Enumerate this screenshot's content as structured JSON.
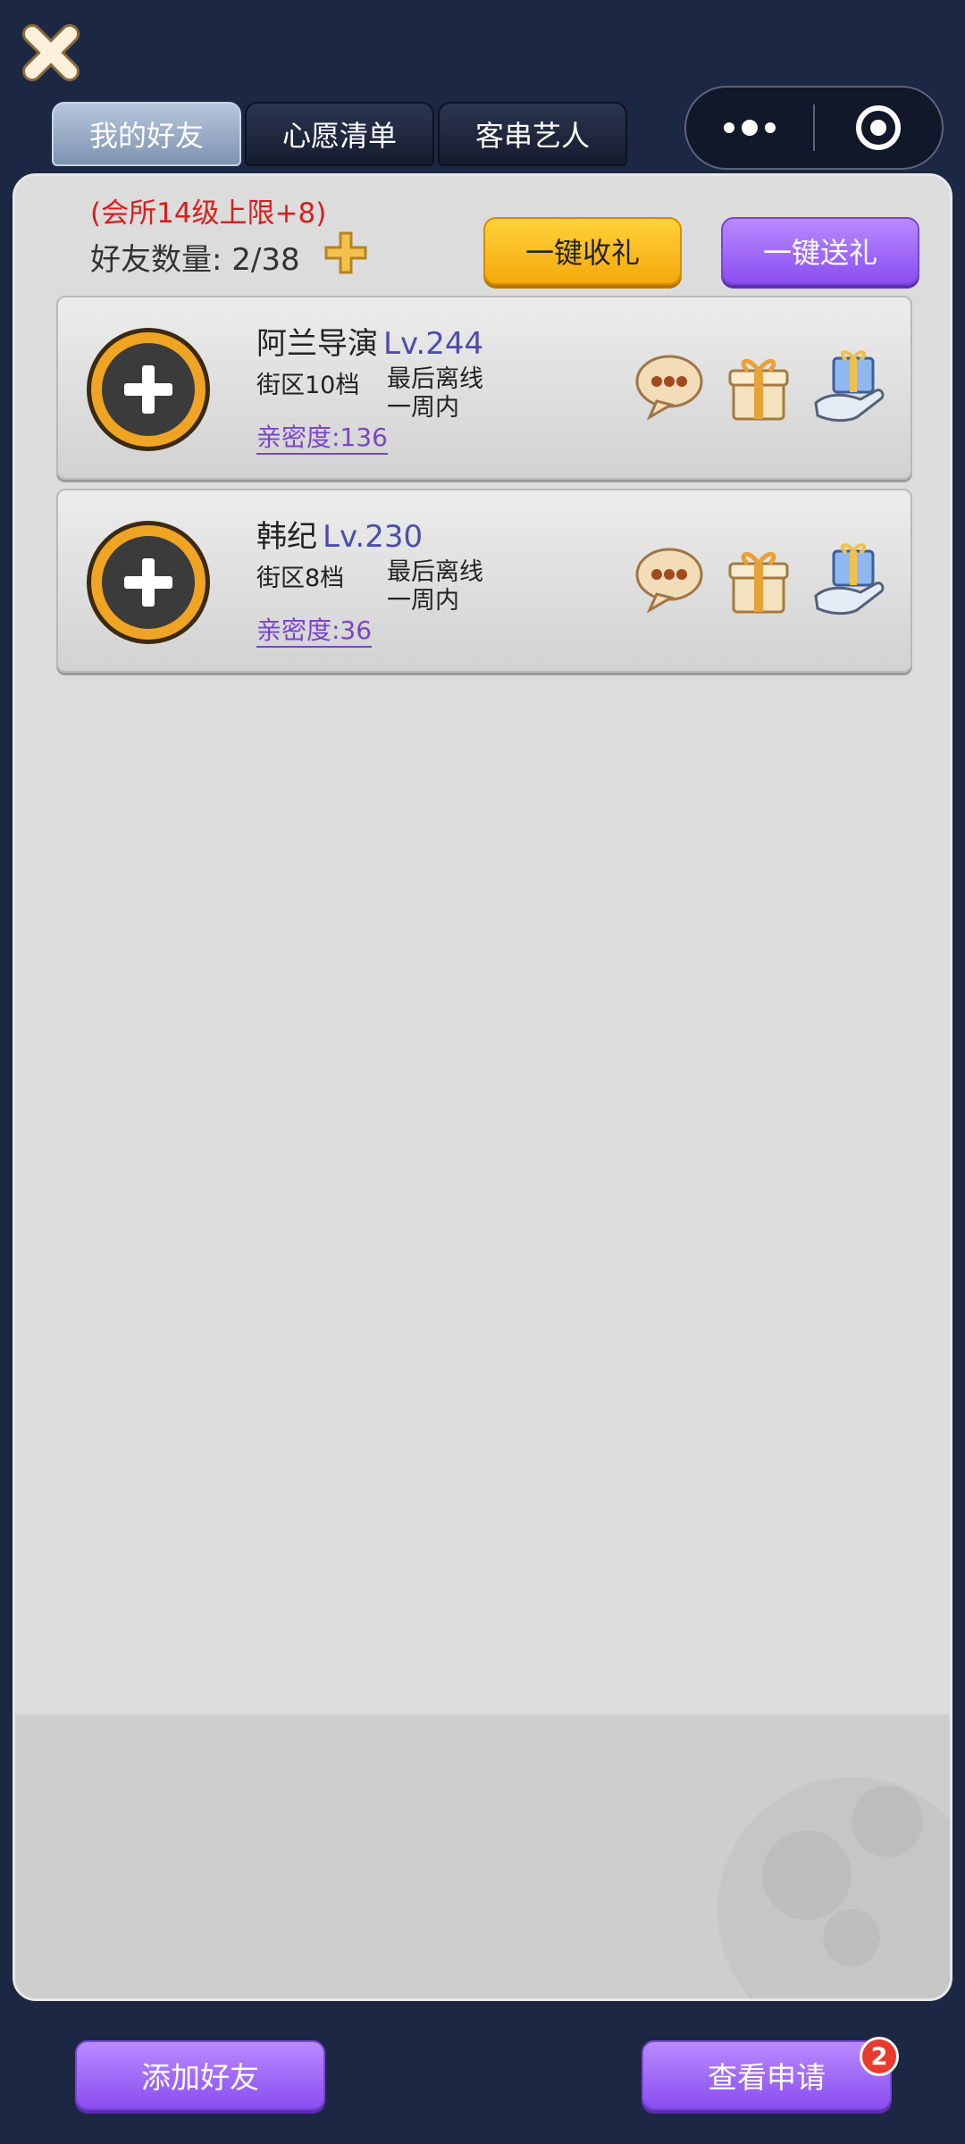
{
  "tabs": [
    {
      "label": "我的好友",
      "active": true
    },
    {
      "label": "心愿清单",
      "active": false
    },
    {
      "label": "客串艺人",
      "active": false
    }
  ],
  "header": {
    "limit_note": "(会所14级上限+8)",
    "friend_count_label": "好友数量: 2/38",
    "receive_all_label": "一键收礼",
    "send_all_label": "一键送礼"
  },
  "friends": [
    {
      "name": "阿兰导演",
      "level": "Lv.244",
      "district": "街区10档",
      "offline_line1": "最后离线",
      "offline_line2": "一周内",
      "intimacy": "亲密度:136"
    },
    {
      "name": "韩纪",
      "level": "Lv.230",
      "district": "街区8档",
      "offline_line1": "最后离线",
      "offline_line2": "一周内",
      "intimacy": "亲密度:36"
    }
  ],
  "footer": {
    "add_friend_label": "添加好友",
    "view_requests_label": "查看申请",
    "requests_badge": "2"
  },
  "icons": {
    "close": "close-icon",
    "menu": "more-dots-icon",
    "target": "target-icon",
    "plus": "plus-icon",
    "chat": "chat-bubble-icon",
    "gift": "gift-box-icon",
    "give": "hand-gift-icon"
  },
  "colors": {
    "background": "#1c2843",
    "panel": "#dcdcdc",
    "accent_purple": "#8a4ef0",
    "accent_yellow": "#f3a90b",
    "level_text": "#4b4dab",
    "note_red": "#d81e1e"
  }
}
